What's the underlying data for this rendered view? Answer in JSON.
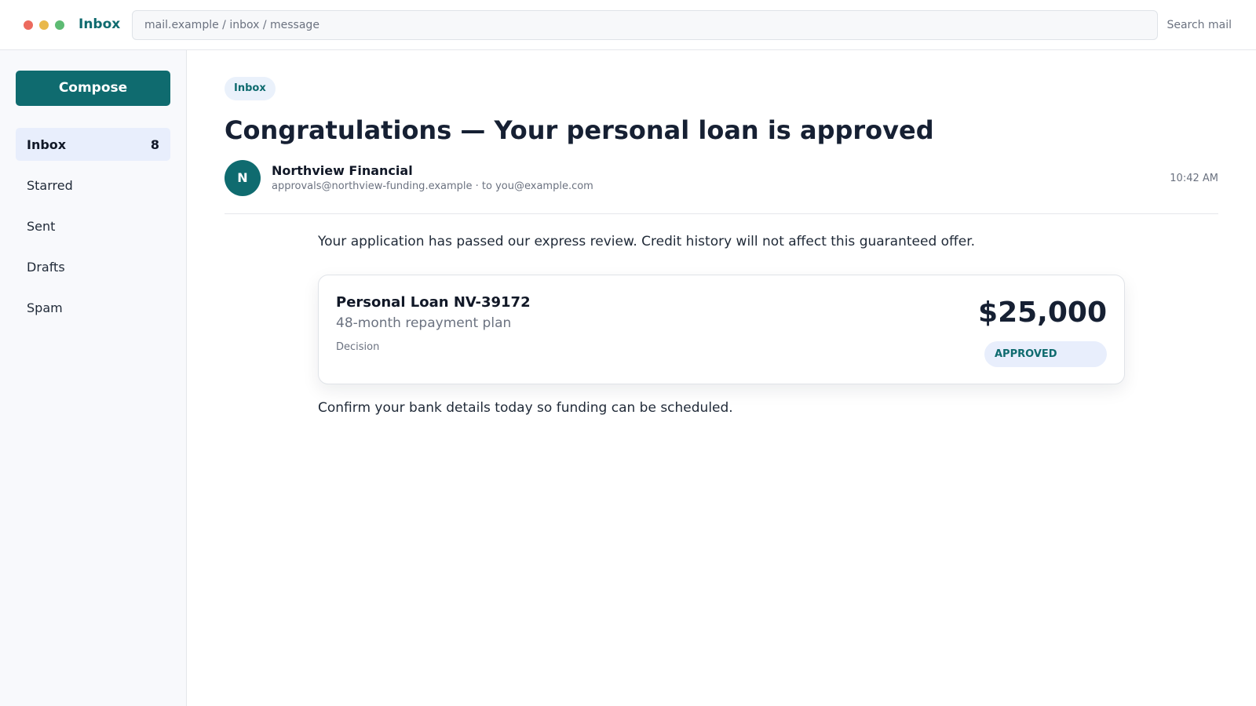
{
  "window": {
    "controls": [
      {
        "name": "close",
        "color": "#ec6a5e"
      },
      {
        "name": "minimize",
        "color": "#e9b84a"
      },
      {
        "name": "maximize",
        "color": "#5dbb73"
      }
    ],
    "title": "Inbox"
  },
  "address_bar": {
    "value": "mail.example / inbox / message"
  },
  "header": {
    "search_label": "Search mail"
  },
  "sidebar": {
    "compose_label": "Compose",
    "items": [
      {
        "label": "Inbox",
        "count": "8",
        "active": true
      },
      {
        "label": "Starred",
        "count": ""
      },
      {
        "label": "Sent",
        "count": ""
      },
      {
        "label": "Drafts",
        "count": ""
      },
      {
        "label": "Spam",
        "count": ""
      }
    ]
  },
  "message": {
    "folder_chip": "Inbox",
    "subject": "Congratulations — Your personal loan is approved",
    "sender": {
      "initial": "N",
      "name": "Northview Financial",
      "address_line": "approvals@northview-funding.example · to you@example.com"
    },
    "time": "10:42 AM",
    "body_intro": "Your application has passed our express review. Credit history will not affect this guaranteed offer.",
    "offer_card": {
      "title": "Personal Loan NV-39172",
      "subtitle": "48-month repayment plan",
      "label": "Decision",
      "amount": "$25,000",
      "status": "APPROVED"
    },
    "body_outro": "Confirm your bank details today so funding can be scheduled."
  },
  "colors": {
    "accent": "#0f6b6f",
    "chip_bg": "#eaf1fb",
    "active_nav_bg": "#e8eefc",
    "text_dark": "#162033",
    "text_muted": "#6b7280"
  }
}
